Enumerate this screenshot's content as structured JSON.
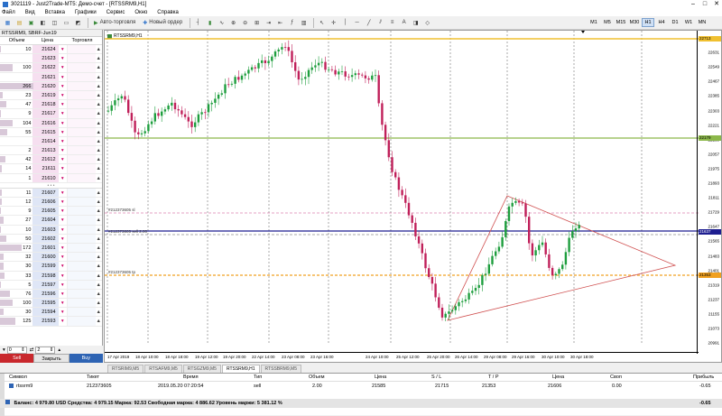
{
  "window": {
    "title": "3021119 - Just2Trade-MT5: Демо-счет - [RTSSRM9,H1]"
  },
  "menu": [
    "Файл",
    "Вид",
    "Вставка",
    "Графики",
    "Сервис",
    "Окно",
    "Справка"
  ],
  "toolbar": {
    "autotrade": "Авто-торговля",
    "neworder": "Новый ордер",
    "timeframes": [
      "M1",
      "M5",
      "M15",
      "M30",
      "H1",
      "H4",
      "D1",
      "W1",
      "MN"
    ],
    "active_tf": "H1"
  },
  "dom": {
    "title": "RTSSRM9, SBRF-Jun19",
    "headers": {
      "volume": "Объем",
      "price": "Цена",
      "trading": "Торговля"
    },
    "asks": [
      {
        "vol": "10",
        "price": "21624"
      },
      {
        "vol": "",
        "price": "21623"
      },
      {
        "vol": "100",
        "price": "21622"
      },
      {
        "vol": "",
        "price": "21621"
      },
      {
        "vol": "266",
        "price": "21620"
      },
      {
        "vol": "23",
        "price": "21619"
      },
      {
        "vol": "47",
        "price": "21618"
      },
      {
        "vol": "9",
        "price": "21617"
      },
      {
        "vol": "104",
        "price": "21616"
      },
      {
        "vol": "55",
        "price": "21615"
      },
      {
        "vol": "",
        "price": "21614"
      },
      {
        "vol": "2",
        "price": "21613"
      },
      {
        "vol": "42",
        "price": "21612"
      },
      {
        "vol": "14",
        "price": "21611"
      },
      {
        "vol": "1",
        "price": "21610"
      }
    ],
    "separator": "• • •",
    "bids": [
      {
        "vol": "11",
        "price": "21607"
      },
      {
        "vol": "12",
        "price": "21606"
      },
      {
        "vol": "9",
        "price": "21605"
      },
      {
        "vol": "27",
        "price": "21604"
      },
      {
        "vol": "10",
        "price": "21603"
      },
      {
        "vol": "50",
        "price": "21602"
      },
      {
        "vol": "172",
        "price": "21601"
      },
      {
        "vol": "32",
        "price": "21600"
      },
      {
        "vol": "30",
        "price": "21599"
      },
      {
        "vol": "33",
        "price": "21598"
      },
      {
        "vol": "5",
        "price": "21597"
      },
      {
        "vol": "76",
        "price": "21596"
      },
      {
        "vol": "100",
        "price": "21595"
      },
      {
        "vol": "30",
        "price": "21594"
      },
      {
        "vol": "125",
        "price": "21593"
      }
    ],
    "qty1": "0",
    "qty2": "2",
    "sell": "Sell",
    "close": "Закрыть",
    "buy": "Buy"
  },
  "chart": {
    "symbol_label": "RTSSRM9,H1",
    "price_labels": [
      "22713",
      "22631",
      "22549",
      "22467",
      "22385",
      "22303",
      "22221",
      "22139",
      "22057",
      "21975",
      "21893",
      "21811",
      "21729",
      "21647",
      "21565",
      "21483",
      "21401",
      "21319",
      "21237",
      "21155",
      "21073",
      "20991"
    ],
    "highlights": [
      {
        "text": "22713",
        "color": "#f0c030"
      },
      {
        "text": "22179",
        "color": "#8cb84a"
      },
      {
        "text": "21637",
        "color": "#1e1e90"
      },
      {
        "text": "21353",
        "color": "#f0a020"
      }
    ],
    "line_labels": [
      "#212373605 sl",
      "#212373605 sell 2.00",
      "#212373605 tp"
    ],
    "time_labels": [
      "17 Apr 2019",
      "18 Apr 10:00",
      "18 Apr 18:00",
      "19 Apr 12:00",
      "19 Apr 20:00",
      "22 Apr 14:00",
      "23 Apr 08:00",
      "23 Apr 16:00",
      "24 Apr 10:00",
      "25 Apr 12:00",
      "25 Apr 20:00",
      "26 Apr 14:00",
      "29 Apr 08:00",
      "29 Apr 16:00",
      "30 Apr 10:00",
      "30 Apr 18:00"
    ]
  },
  "tabs": [
    "RTSRIM9,M5",
    "RTSAFM9,M5",
    "RTSGZM9,M5",
    "RTSSRM9,H1",
    "RTSSBRM9,M5"
  ],
  "active_tab": "RTSSRM9,H1",
  "trade": {
    "headers": [
      "Символ",
      "Тикет",
      "Время",
      "Тип",
      "Объем",
      "Цена",
      "S / L",
      "T / P",
      "Цена",
      "Своп",
      "Прибыль"
    ],
    "row": [
      "rtssrm9",
      "212373605",
      "2019.05.20 07:20:54",
      "sell",
      "2.00",
      "21585",
      "21715",
      "21353",
      "21606",
      "0.00",
      "-0.65"
    ],
    "balance_text": "Баланс: 4 979.80 USD  Средства: 4 979.15  Маржа: 92.53  Свободная маржа: 4 886.62  Уровень маржи: 5 381.12 %",
    "balance_profit": "-0.65"
  }
}
